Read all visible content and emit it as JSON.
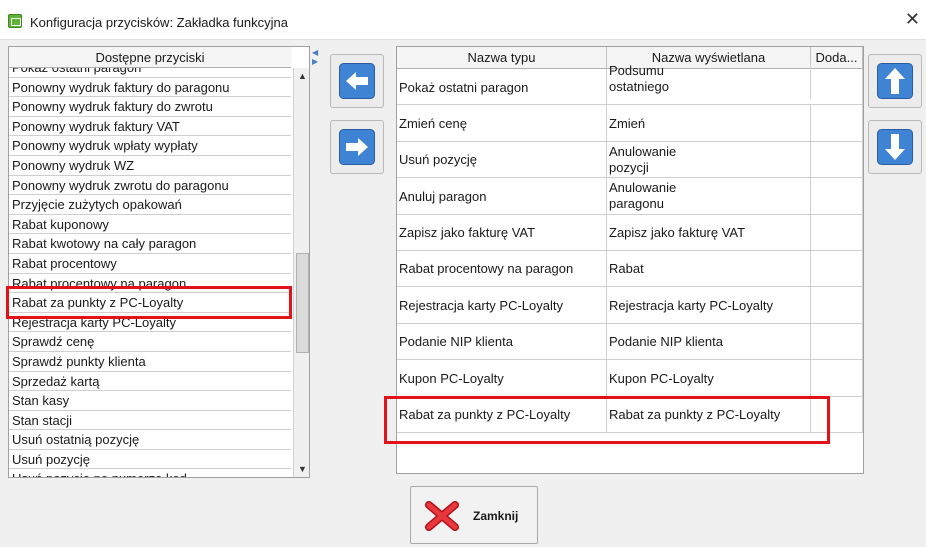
{
  "window": {
    "title": "Konfiguracja przycisków: Zakładka funkcyjna",
    "close_glyph": "✕"
  },
  "available_buttons": {
    "header": "Dostępne przyciski",
    "items": [
      "Pokaż ostatni paragon",
      "Ponowny wydruk faktury do paragonu",
      "Ponowny wydruk faktury do zwrotu",
      "Ponowny wydruk faktury VAT",
      "Ponowny wydruk wpłaty wypłaty",
      "Ponowny wydruk WZ",
      "Ponowny wydruk zwrotu do paragonu",
      "Przyjęcie zużytych opakowań",
      "Rabat kuponowy",
      "Rabat kwotowy na cały paragon",
      "Rabat procentowy",
      "Rabat procentowy na paragon",
      "Rabat za punkty z PC-Loyalty",
      "Rejestracja karty PC-Loyalty",
      "Sprawdź cenę",
      "Sprawdź punkty klienta",
      "Sprzedaż kartą",
      "Stan kasy",
      "Stan stacji",
      "Usuń ostatnią pozycję",
      "Usuń pozycję",
      "Usuń pozycję po numerze kod"
    ],
    "selected": "Rabat za punkty z PC-Loyalty"
  },
  "nav": {
    "move_left": "left-arrow-icon",
    "move_right": "right-arrow-icon",
    "move_up": "up-arrow-icon",
    "move_down": "down-arrow-icon"
  },
  "assigned_table": {
    "columns": [
      "Nazwa typu",
      "Nazwa wyświetlana",
      "Doda..."
    ],
    "rows": [
      {
        "type": "Pokaż ostatni paragon",
        "display": "Podsumu\nostatniego\nparagonu"
      },
      {
        "type": "Zmień cenę",
        "display": "Zmień"
      },
      {
        "type": "Usuń pozycję",
        "display": "Anulowanie\npozycji"
      },
      {
        "type": "Anuluj paragon",
        "display": "Anulowanie\nparagonu"
      },
      {
        "type": "Zapisz jako fakturę VAT",
        "display": "Zapisz jako fakturę VAT"
      },
      {
        "type": "Rabat procentowy na paragon",
        "display": "Rabat"
      },
      {
        "type": "Rejestracja karty PC-Loyalty",
        "display": "Rejestracja karty PC-Loyalty"
      },
      {
        "type": "Podanie NIP klienta",
        "display": "Podanie NIP klienta"
      },
      {
        "type": "Kupon PC-Loyalty",
        "display": "Kupon PC-Loyalty"
      },
      {
        "type": "Rabat za punkty z PC-Loyalty",
        "display": "Rabat za punkty z PC-Loyalty"
      }
    ]
  },
  "footer": {
    "close_label": "Zamknij",
    "close_icon": "red-x-icon"
  },
  "colors": {
    "highlight": "#e3121a",
    "nav_blue": "#2f6fc0"
  }
}
